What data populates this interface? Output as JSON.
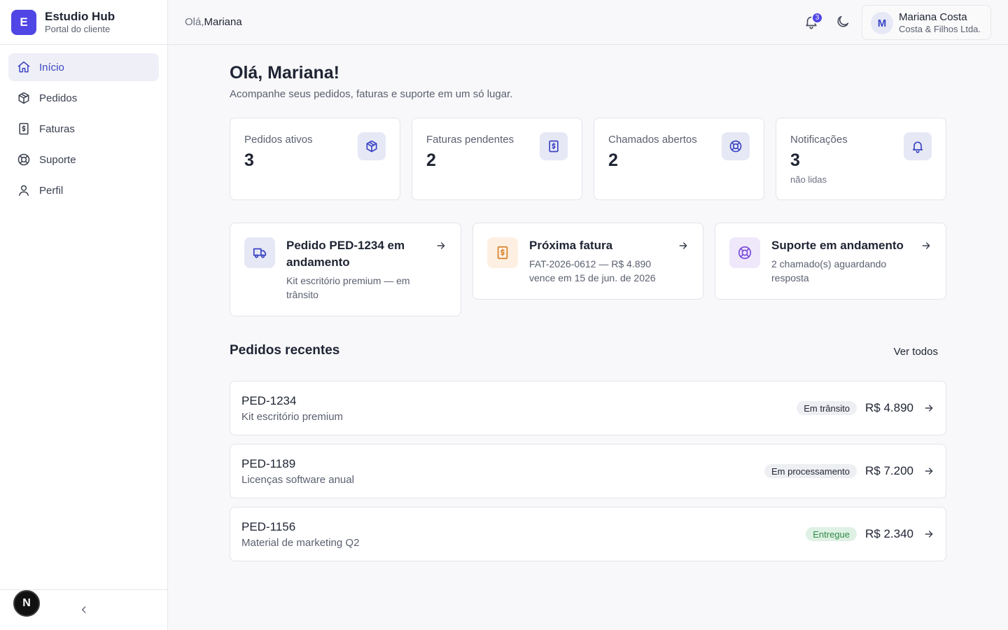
{
  "brand": {
    "logo_letter": "E",
    "name": "Estudio Hub",
    "subtitle": "Portal do cliente"
  },
  "sidebar": {
    "items": [
      {
        "label": "Início",
        "icon": "home-icon",
        "active": true
      },
      {
        "label": "Pedidos",
        "icon": "package-icon"
      },
      {
        "label": "Faturas",
        "icon": "receipt-icon"
      },
      {
        "label": "Suporte",
        "icon": "lifebuoy-icon"
      },
      {
        "label": "Perfil",
        "icon": "user-icon"
      }
    ],
    "dev_badge": "N"
  },
  "topbar": {
    "greeting_prefix": "Olá,",
    "greeting_name": "Mariana",
    "notification_count": "3",
    "user": {
      "initial": "M",
      "name": "Mariana Costa",
      "company": "Costa & Filhos Ltda."
    }
  },
  "page": {
    "title": "Olá, Mariana!",
    "subtitle": "Acompanhe seus pedidos, faturas e suporte em um só lugar."
  },
  "stats": [
    {
      "label": "Pedidos ativos",
      "value": "3",
      "extra": "",
      "icon": "package-icon"
    },
    {
      "label": "Faturas pendentes",
      "value": "2",
      "extra": "",
      "icon": "receipt-icon"
    },
    {
      "label": "Chamados abertos",
      "value": "2",
      "extra": "",
      "icon": "lifebuoy-icon"
    },
    {
      "label": "Notificações",
      "value": "3",
      "extra": "não lidas",
      "icon": "bell-icon"
    }
  ],
  "actions": [
    {
      "title": "Pedido PED-1234 em andamento",
      "desc": "Kit escritório premium — em trânsito",
      "icon": "truck-icon",
      "color": "#3b45c4",
      "bg": "#e6e8f6"
    },
    {
      "title": "Próxima fatura",
      "desc": "FAT-2026-0612 — R$ 4.890 vence em 15 de jun. de 2026",
      "icon": "receipt-icon",
      "color": "#d9822b",
      "bg": "#fdf0e2"
    },
    {
      "title": "Suporte em andamento",
      "desc": "2 chamado(s) aguardando resposta",
      "icon": "lifebuoy-icon",
      "color": "#7c4ddb",
      "bg": "#efe8fb"
    }
  ],
  "recent": {
    "title": "Pedidos recentes",
    "see_all": "Ver todos",
    "orders": [
      {
        "id": "PED-1234",
        "desc": "Kit escritório premium",
        "status": "Em trânsito",
        "status_type": "neutral",
        "amount": "R$ 4.890"
      },
      {
        "id": "PED-1189",
        "desc": "Licenças software anual",
        "status": "Em processamento",
        "status_type": "neutral",
        "amount": "R$ 7.200"
      },
      {
        "id": "PED-1156",
        "desc": "Material de marketing Q2",
        "status": "Entregue",
        "status_type": "success",
        "amount": "R$ 2.340"
      }
    ]
  },
  "colors": {
    "accent": "#4f46e5",
    "accent_soft": "#e6e8f6",
    "success": "#2f8a47",
    "background": "#f8f8fa"
  }
}
